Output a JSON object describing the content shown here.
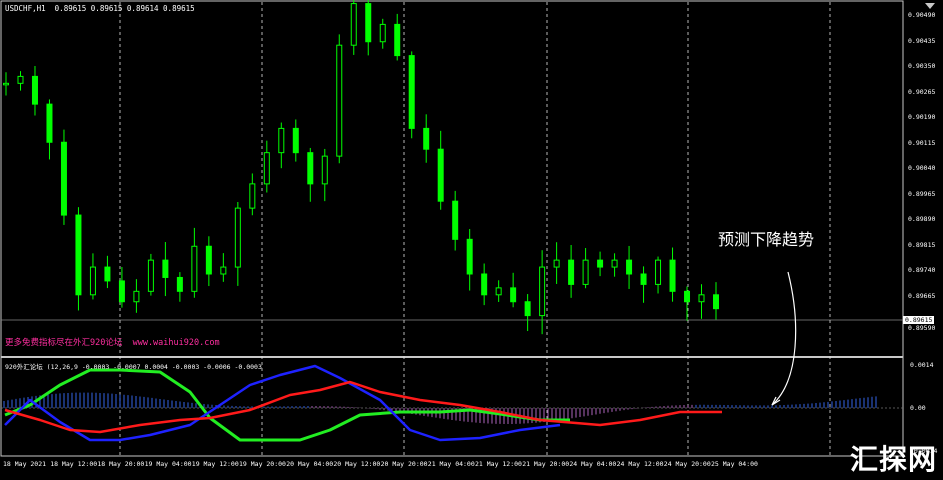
{
  "chart": {
    "symbol_title": "USDCHF,H1  0.89615 0.89615 0.89614 0.89615",
    "current_price_tag": "0.89615",
    "ad_text": "更多免费指标尽在外汇920论坛  www.waihui920.com",
    "annotation": "预测下降趋势",
    "watermark": "汇探网"
  },
  "indicator": {
    "title": "920外汇论坛 (12,26,9 -0.0003 -0.0007 0.0004 -0.0003 -0.0006 -0.0003",
    "levels": [
      "0.0014",
      "0.00",
      "-0.0014"
    ]
  },
  "price_axis": [
    "0.90490",
    "0.90435",
    "0.90350",
    "0.90265",
    "0.90190",
    "0.90115",
    "0.90040",
    "0.89965",
    "0.89890",
    "0.89815",
    "0.89740",
    "0.89665",
    "0.89590"
  ],
  "time_axis": [
    "18 May 2021",
    "18 May 12:00",
    "18 May 20:00",
    "19 May 04:00",
    "19 May 12:00",
    "19 May 20:00",
    "20 May 04:00",
    "20 May 12:00",
    "20 May 20:00",
    "21 May 04:00",
    "21 May 12:00",
    "21 May 20:00",
    "24 May 04:00",
    "24 May 12:00",
    "24 May 20:00",
    "25 May 04:00"
  ],
  "colors": {
    "bull": "#00ff00",
    "bear": "#00ff00",
    "grid": "#c8c8c8",
    "line_green": "#22ee22",
    "line_blue": "#1e22ff",
    "line_red": "#ff1a1a",
    "hist_blue": "#3a6fff",
    "hist_pink": "#c070d0"
  },
  "chart_data": {
    "type": "line",
    "title": "USDCHF,H1",
    "series": [
      {
        "name": "close",
        "values": [
          0.9029,
          0.9031,
          0.9023,
          0.9012,
          0.8991,
          0.8968,
          0.8976,
          0.8972,
          0.8966,
          0.8969,
          0.8978,
          0.8973,
          0.8969,
          0.8982,
          0.8974,
          0.8976,
          0.8993,
          0.9,
          0.9009,
          0.9016,
          0.9009,
          0.9,
          0.9008,
          0.904,
          0.9052,
          0.9041,
          0.9046,
          0.9037,
          0.9016,
          0.901,
          0.8995,
          0.8984,
          0.8974,
          0.8968,
          0.897,
          0.8966,
          0.8962,
          0.8976,
          0.8978,
          0.8971,
          0.8978,
          0.8976,
          0.8978,
          0.8974,
          0.8971,
          0.8978,
          0.8969,
          0.8966,
          0.8968,
          0.8964
        ]
      }
    ]
  }
}
